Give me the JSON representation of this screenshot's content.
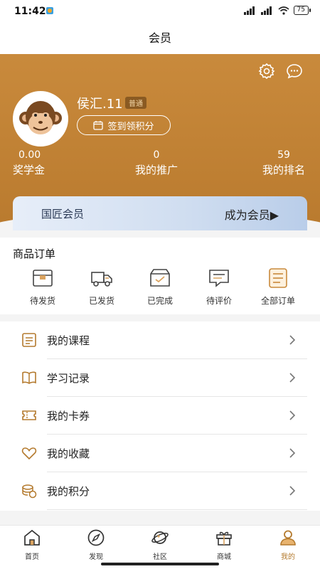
{
  "status": {
    "time": "11:42",
    "battery": "75"
  },
  "nav": {
    "title": "会员"
  },
  "profile": {
    "username": "侯汇.11",
    "badge": "普通",
    "checkin_label": "签到领积分"
  },
  "stats": [
    {
      "num": "0.00",
      "label": "奖学金"
    },
    {
      "num": "0",
      "label": "我的推广"
    },
    {
      "num": "59",
      "label": "我的排名"
    }
  ],
  "vip": {
    "left": "国匠会员",
    "right": "成为会员▶"
  },
  "orders": {
    "title": "商品订单",
    "items": [
      {
        "label": "待发货",
        "icon": "box-icon"
      },
      {
        "label": "已发货",
        "icon": "truck-icon"
      },
      {
        "label": "已完成",
        "icon": "inbox-check-icon"
      },
      {
        "label": "待评价",
        "icon": "comment-icon"
      },
      {
        "label": "全部订单",
        "icon": "list-icon"
      }
    ]
  },
  "menu": [
    {
      "label": "我的课程",
      "icon": "course-icon"
    },
    {
      "label": "学习记录",
      "icon": "book-icon"
    },
    {
      "label": "我的卡券",
      "icon": "ticket-icon"
    },
    {
      "label": "我的收藏",
      "icon": "heart-icon"
    },
    {
      "label": "我的积分",
      "icon": "coins-icon"
    }
  ],
  "tabs": [
    {
      "label": "首页",
      "icon": "home-icon"
    },
    {
      "label": "发现",
      "icon": "compass-icon"
    },
    {
      "label": "社区",
      "icon": "planet-icon"
    },
    {
      "label": "商城",
      "icon": "gift-icon"
    },
    {
      "label": "我的",
      "icon": "user-icon",
      "active": true
    }
  ],
  "colors": {
    "accent": "#b97a2e",
    "hero_top": "#c98a3c",
    "vip_bg": "#cfddf0"
  }
}
